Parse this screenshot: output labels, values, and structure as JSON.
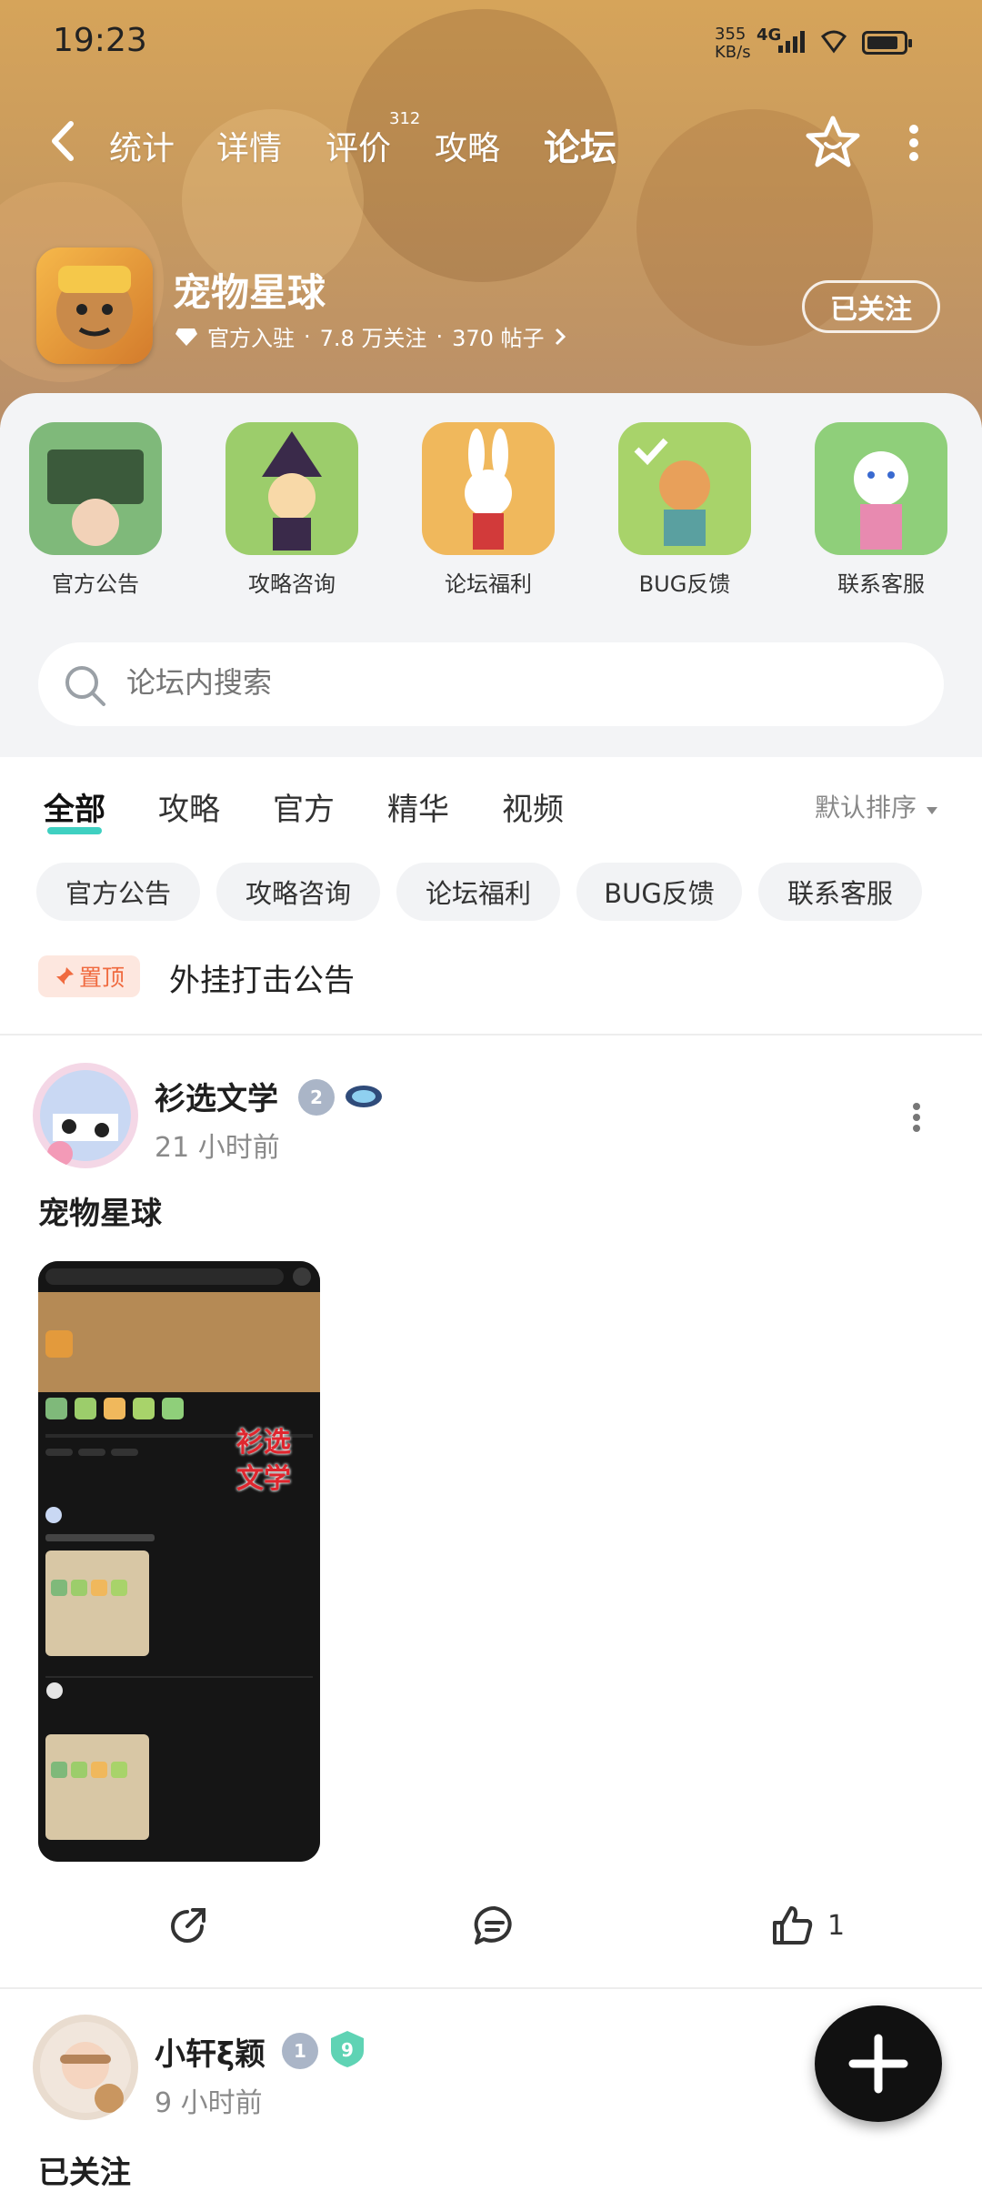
{
  "status_bar": {
    "time": "19:23",
    "net_speed_value": "355",
    "net_speed_unit": "KB/s",
    "network": "4G"
  },
  "nav": {
    "tabs": [
      "统计",
      "详情",
      "评价",
      "攻略",
      "论坛"
    ],
    "review_count": "312",
    "active_tab": "论坛"
  },
  "game": {
    "title": "宠物星球",
    "official_label": "官方入驻",
    "followers": "7.8 万关注",
    "posts": "370 帖子",
    "follow_button": "已关注"
  },
  "categories": [
    {
      "label": "官方公告",
      "color": "#7fb97a"
    },
    {
      "label": "攻略咨询",
      "color": "#9ccd6b"
    },
    {
      "label": "论坛福利",
      "color": "#f0b85c"
    },
    {
      "label": "BUG反馈",
      "color": "#a8d36a"
    },
    {
      "label": "联系客服",
      "color": "#8fcf7a"
    }
  ],
  "search": {
    "placeholder": "论坛内搜索"
  },
  "filters": {
    "tabs": [
      "全部",
      "攻略",
      "官方",
      "精华",
      "视频"
    ],
    "active": "全部",
    "sort_label": "默认排序",
    "chips": [
      "官方公告",
      "攻略咨询",
      "论坛福利",
      "BUG反馈",
      "联系客服"
    ]
  },
  "pinned": {
    "badge": "置顶",
    "title": "外挂打击公告"
  },
  "posts": [
    {
      "author": "衫选文学",
      "level": "2",
      "time": "21 小时前",
      "title": "宠物星球",
      "image_overlay": [
        "衫选",
        "文学"
      ],
      "likes": "1"
    },
    {
      "author": "小轩ξ颖",
      "level": "1",
      "time": "9 小时前",
      "title": "已关注"
    }
  ],
  "colors": {
    "accent": "#3fd0c1",
    "pin": "#f06a3f",
    "banner": "#d6a45a"
  }
}
